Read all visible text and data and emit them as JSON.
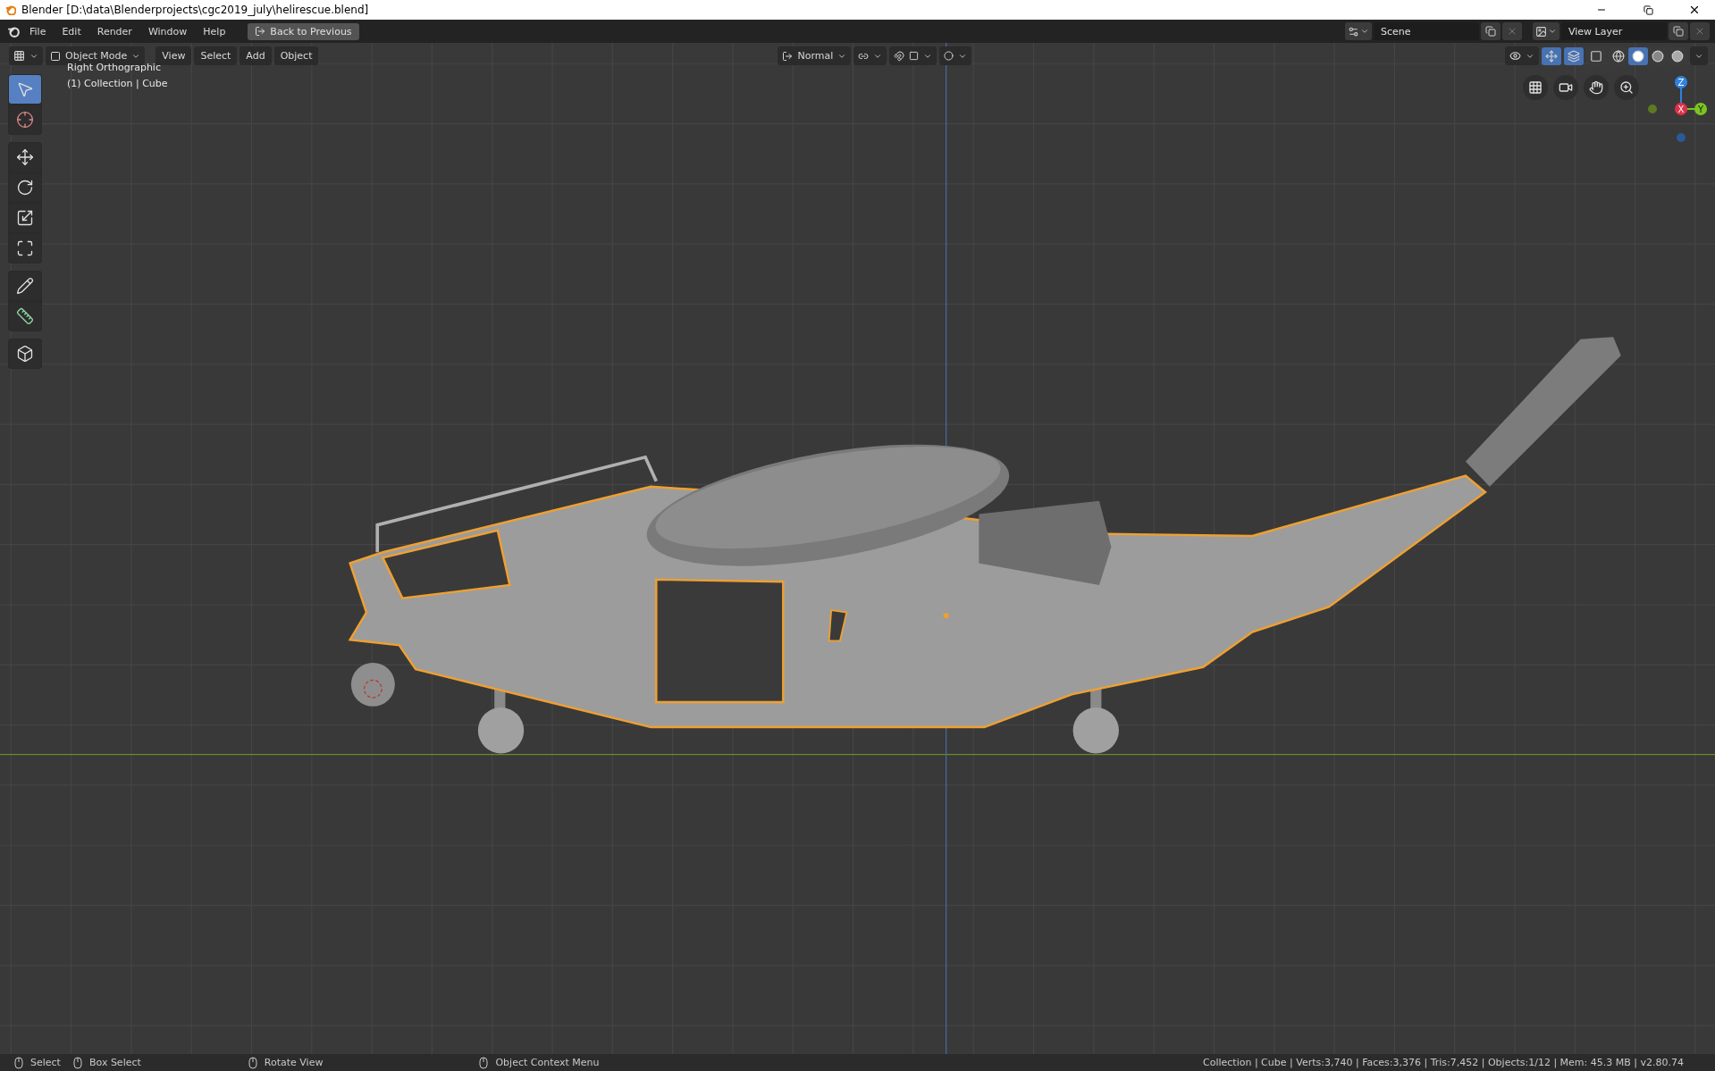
{
  "window": {
    "title": "Blender [D:\\data\\Blenderprojects\\cgc2019_july\\helirescue.blend]"
  },
  "menu": [
    "File",
    "Edit",
    "Render",
    "Window",
    "Help"
  ],
  "back_button": "Back to Previous",
  "scene": {
    "value": "Scene"
  },
  "view_layer": {
    "value": "View Layer"
  },
  "header": {
    "mode": "Object Mode",
    "menus": [
      "View",
      "Select",
      "Add",
      "Object"
    ],
    "orientation": "Normal"
  },
  "header_toggles": [
    {
      "kind": "gizmo",
      "on": true
    },
    {
      "kind": "overlay",
      "on": true
    },
    {
      "kind": "xray",
      "on": false
    }
  ],
  "shading": [
    {
      "kind": "wireframe",
      "selected": false
    },
    {
      "kind": "solid",
      "selected": true
    },
    {
      "kind": "material",
      "selected": false
    },
    {
      "kind": "rendered",
      "selected": false
    }
  ],
  "overlay_text": [
    "Right Orthographic",
    "(1) Collection | Cube"
  ],
  "tools": [
    [
      {
        "kind": "select",
        "selected": true
      },
      {
        "kind": "cursor",
        "selected": false
      }
    ],
    [
      {
        "kind": "move",
        "selected": false
      },
      {
        "kind": "rotate",
        "selected": false
      },
      {
        "kind": "scale",
        "selected": false
      },
      {
        "kind": "transform",
        "selected": false
      }
    ],
    [
      {
        "kind": "annotate",
        "selected": false
      },
      {
        "kind": "measure",
        "selected": false
      }
    ],
    [
      {
        "kind": "add-cube",
        "selected": false
      }
    ]
  ],
  "gizmo": {
    "z": "Z",
    "x": "X",
    "y": "Y"
  },
  "status_bar": {
    "hints": [
      "Select",
      "Box Select",
      "Rotate View",
      "Object Context Menu"
    ],
    "stats": "Collection | Cube | Verts:3,740 | Faces:3,376 | Tris:7,452 | Objects:1/12 | Mem: 45.3 MB | v2.80.74"
  }
}
